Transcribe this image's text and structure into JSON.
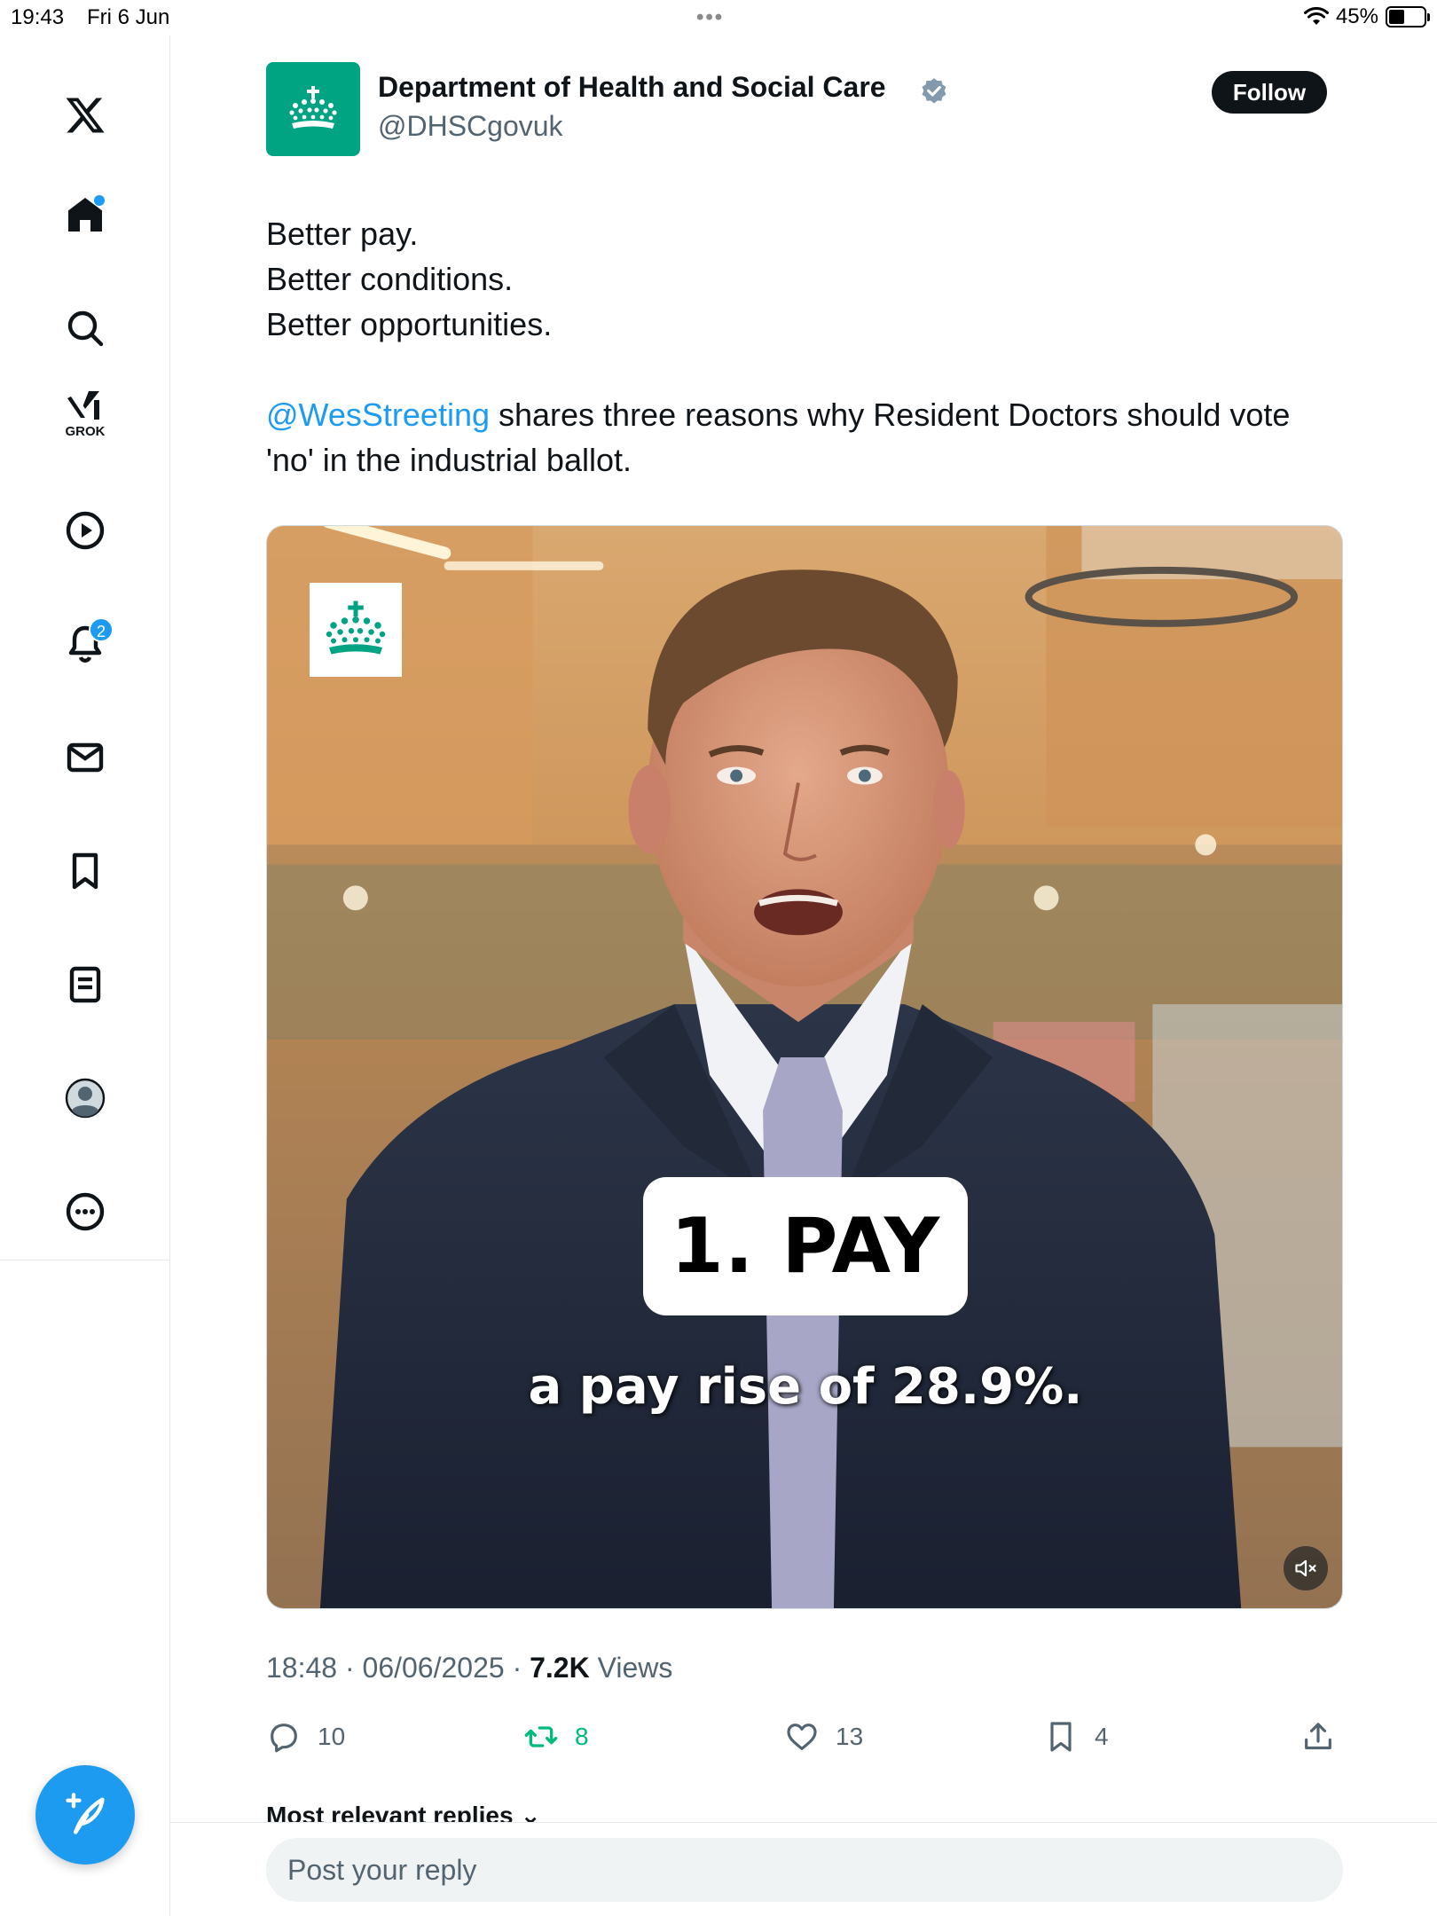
{
  "status_bar": {
    "time": "19:43",
    "date": "Fri 6 Jun",
    "dots": "•••",
    "battery": "45%",
    "battery_level": 0.45
  },
  "nav": {
    "grok_label": "GROK",
    "notifications_badge": "2",
    "icons": [
      "x-logo-icon",
      "home-icon",
      "search-icon",
      "grok-icon",
      "video-icon",
      "notifications-icon",
      "messages-icon",
      "bookmarks-icon",
      "lists-icon",
      "profile-icon",
      "more-icon",
      "compose-icon"
    ]
  },
  "tweet": {
    "author_name": "Department of Health and Social Care",
    "author_handle": "@DHSCgovuk",
    "follow_label": "Follow",
    "lines": [
      "Better pay.",
      "Better conditions.",
      "Better opportunities."
    ],
    "mention": "@WesStreeting",
    "body_rest": " shares three reasons why Resident Doctors should vote 'no' in the industrial ballot.",
    "media": {
      "caption_title": "1. PAY",
      "caption_subtitle": "a pay rise of 28.9%."
    },
    "time": "18:48",
    "date": "06/06/2025",
    "views_count": "7.2K",
    "views_label": "Views",
    "replies": "10",
    "reposts": "8",
    "likes": "13",
    "bookmarks": "4"
  },
  "colors": {
    "accent": "#1d9bf0",
    "brand_green": "#00a382",
    "repost_green": "#00ba7c"
  },
  "replies_sort": "Most relevant replies",
  "reply_placeholder": "Post your reply"
}
